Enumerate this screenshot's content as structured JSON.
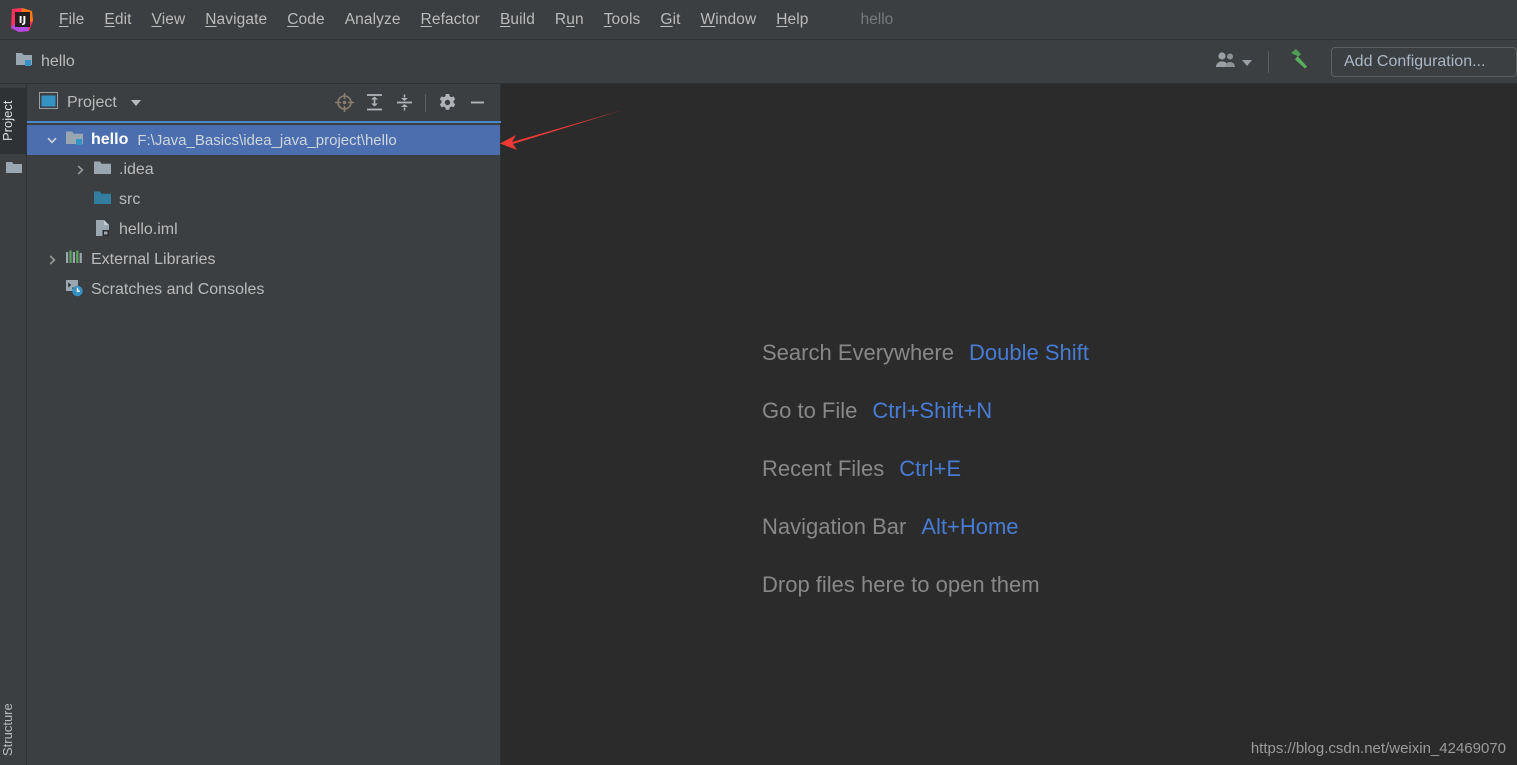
{
  "window": {
    "app_logo": "intellij-idea-logo",
    "project_name_in_menubar": "hello"
  },
  "menubar": {
    "items": [
      {
        "label": "File",
        "mnemonic": "F"
      },
      {
        "label": "Edit",
        "mnemonic": "E"
      },
      {
        "label": "View",
        "mnemonic": "V"
      },
      {
        "label": "Navigate",
        "mnemonic": "N"
      },
      {
        "label": "Code",
        "mnemonic": "C"
      },
      {
        "label": "Analyze",
        "mnemonic": ""
      },
      {
        "label": "Refactor",
        "mnemonic": "R"
      },
      {
        "label": "Build",
        "mnemonic": "B"
      },
      {
        "label": "Run",
        "mnemonic": "u"
      },
      {
        "label": "Tools",
        "mnemonic": "T"
      },
      {
        "label": "Git",
        "mnemonic": "G"
      },
      {
        "label": "Window",
        "mnemonic": "W"
      },
      {
        "label": "Help",
        "mnemonic": "H"
      }
    ]
  },
  "navbar": {
    "breadcrumb_label": "hello",
    "breadcrumb_icon": "project-folder-icon",
    "user_icon": "people-icon",
    "user_caret_icon": "chevron-down-icon",
    "build_icon": "hammer-icon",
    "add_configuration_label": "Add Configuration..."
  },
  "stripe": {
    "tab_project": "Project",
    "tab_structure": "Structure",
    "favorites_icon": "folder-icon"
  },
  "project_panel": {
    "title": "Project",
    "title_icon": "project-window-icon",
    "tools": [
      {
        "name": "locate-in-tree-icon"
      },
      {
        "name": "expand-all-icon"
      },
      {
        "name": "collapse-all-icon"
      },
      {
        "name": "settings-gear-icon"
      },
      {
        "name": "hide-window-icon"
      }
    ],
    "tree": [
      {
        "label": "hello",
        "path": "F:\\Java_Basics\\idea_java_project\\hello",
        "icon": "project-root-icon",
        "arrow": "expanded",
        "indent": 0,
        "selected": true,
        "bold": true
      },
      {
        "label": ".idea",
        "path": "",
        "icon": "folder-gray-icon",
        "arrow": "collapsed",
        "indent": 1,
        "selected": false,
        "bold": false
      },
      {
        "label": "src",
        "path": "",
        "icon": "source-folder-icon",
        "arrow": "none",
        "indent": 1,
        "selected": false,
        "bold": false
      },
      {
        "label": "hello.iml",
        "path": "",
        "icon": "module-file-icon",
        "arrow": "none",
        "indent": 1,
        "selected": false,
        "bold": false
      },
      {
        "label": "External Libraries",
        "path": "",
        "icon": "libraries-icon",
        "arrow": "collapsed",
        "indent": 0,
        "selected": false,
        "bold": false
      },
      {
        "label": "Scratches and Consoles",
        "path": "",
        "icon": "scratches-icon",
        "arrow": "none",
        "indent": 0,
        "selected": false,
        "bold": false
      }
    ]
  },
  "editor": {
    "hints": [
      {
        "label": "Search Everywhere",
        "key": "Double Shift"
      },
      {
        "label": "Go to File",
        "key": "Ctrl+Shift+N"
      },
      {
        "label": "Recent Files",
        "key": "Ctrl+E"
      },
      {
        "label": "Navigation Bar",
        "key": "Alt+Home"
      },
      {
        "label": "Drop files here to open them",
        "key": ""
      }
    ],
    "watermark": "https://blog.csdn.net/weixin_42469070"
  },
  "annotation": {
    "arrow": "red-arrow-pointing-to-project-root",
    "color": "#f03a36"
  },
  "colors": {
    "chrome": "#3c3f41",
    "editor_bg": "#2b2b2b",
    "selection": "#4b6eaf",
    "accent_blue": "#477bd4",
    "text": "#bbbbbb",
    "source_folder": "#3b7e9e"
  }
}
